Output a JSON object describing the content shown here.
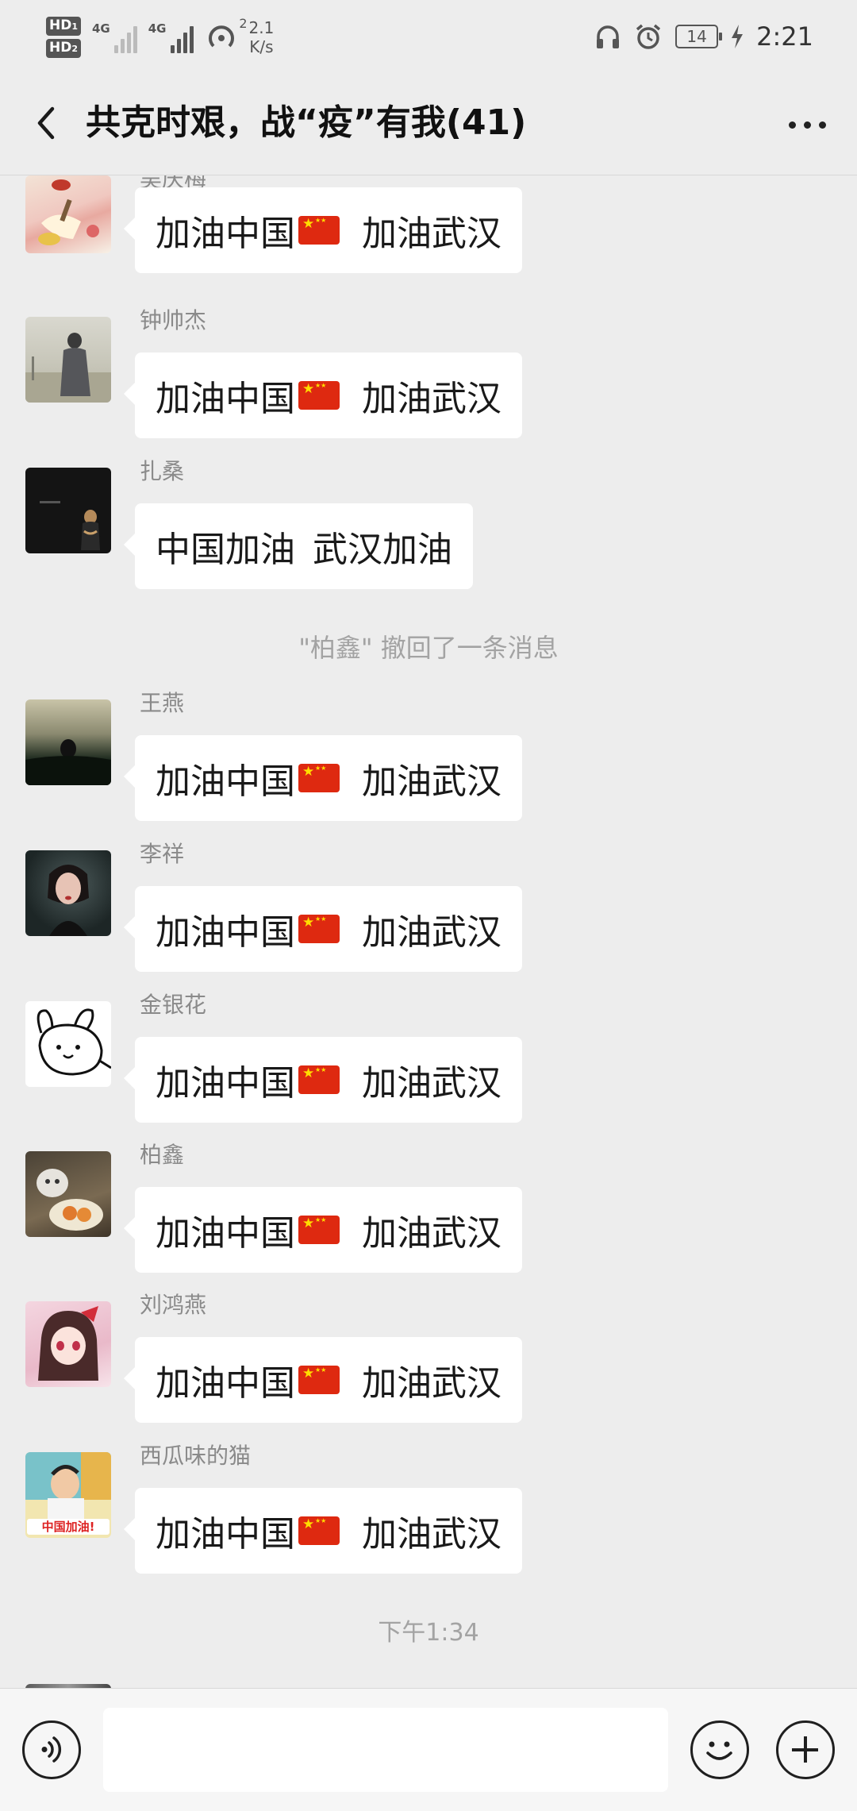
{
  "status_bar": {
    "hd1": "HD",
    "hd1_sub": "1",
    "hd2": "HD",
    "hd2_sub": "2",
    "net1": "4G",
    "net2": "4G",
    "hotspot_count": "2",
    "speed_value": "2.1",
    "speed_unit": "K/s",
    "battery": "14",
    "time": "2:21"
  },
  "nav": {
    "title": "共克时艰，战“疫”有我(41)"
  },
  "messages": [
    {
      "sender": "吴庆梅",
      "text_a": "加油中国",
      "flag": true,
      "text_b": "加油武汉",
      "avatar": "avatar-wu"
    },
    {
      "sender": "钟帅杰",
      "text_a": "加油中国",
      "flag": true,
      "text_b": "加油武汉",
      "avatar": "avatar-zhong"
    },
    {
      "sender": "扎桑",
      "text_a": "中国加油",
      "flag": false,
      "text_b": "武汉加油",
      "avatar": "avatar-zha"
    },
    {
      "sender": "王燕",
      "text_a": "加油中国",
      "flag": true,
      "text_b": "加油武汉",
      "avatar": "avatar-wang"
    },
    {
      "sender": "李祥",
      "text_a": "加油中国",
      "flag": true,
      "text_b": "加油武汉",
      "avatar": "avatar-li"
    },
    {
      "sender": "金银花",
      "text_a": "加油中国",
      "flag": true,
      "text_b": "加油武汉",
      "avatar": "avatar-jin"
    },
    {
      "sender": "柏鑫",
      "text_a": "加油中国",
      "flag": true,
      "text_b": "加油武汉",
      "avatar": "avatar-bai"
    },
    {
      "sender": "刘鸿燕",
      "text_a": "加油中国",
      "flag": true,
      "text_b": "加油武汉",
      "avatar": "avatar-liu"
    },
    {
      "sender": "西瓜味的猫",
      "text_a": "加油中国",
      "flag": true,
      "text_b": "加油武汉",
      "avatar": "avatar-xigua"
    }
  ],
  "recall_notice": "\"柏鑫\" 撤回了一条消息",
  "timestamp": "下午1:34",
  "avatar_badge_text": "中国加油!",
  "input": {
    "placeholder": "",
    "value": ""
  },
  "icons": {
    "back": "chevron-left-icon",
    "more": "more-dots-icon",
    "voice": "voice-icon",
    "emoji": "emoji-icon",
    "plus": "plus-icon"
  },
  "colors": {
    "background": "#ededed",
    "bubble": "#ffffff",
    "flag_red": "#de2910",
    "flag_yellow": "#ffde00"
  }
}
